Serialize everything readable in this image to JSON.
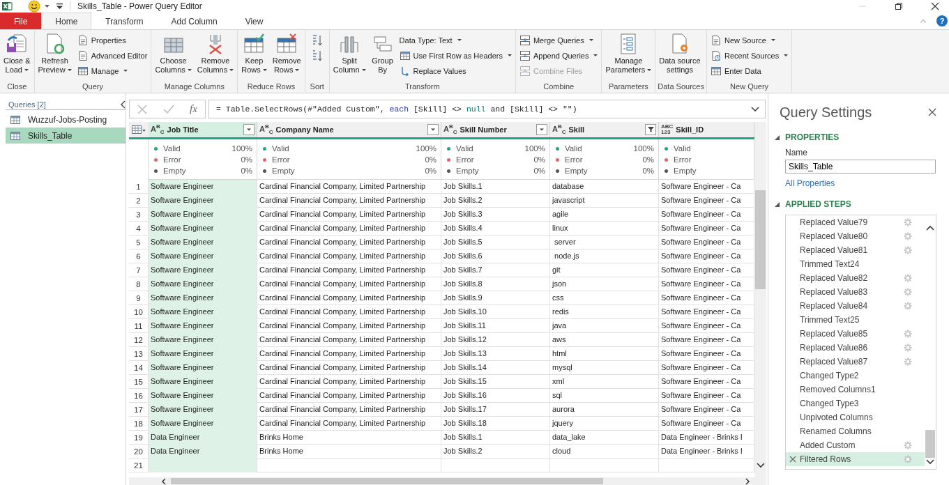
{
  "window": {
    "title": "Skills_Table - Power Query Editor"
  },
  "tabs": [
    {
      "label": "File",
      "kind": "file",
      "selected": false
    },
    {
      "label": "Home",
      "kind": "tab",
      "selected": true
    },
    {
      "label": "Transform",
      "kind": "tab",
      "selected": false
    },
    {
      "label": "Add Column",
      "kind": "tab",
      "selected": false
    },
    {
      "label": "View",
      "kind": "tab",
      "selected": false
    }
  ],
  "help": {
    "label": "?"
  },
  "ribbon": {
    "groups": [
      {
        "label": "Close",
        "items": [
          {
            "kind": "large",
            "lines": [
              "Close &",
              "Load"
            ],
            "dropdown": true
          }
        ]
      },
      {
        "label": "Query",
        "items": [
          {
            "kind": "large",
            "lines": [
              "Refresh",
              "Preview"
            ],
            "dropdown": true
          },
          {
            "kind": "stack",
            "items": [
              {
                "label": "Properties",
                "dropdown": false,
                "disabled": false
              },
              {
                "label": "Advanced Editor",
                "dropdown": false,
                "disabled": false
              },
              {
                "label": "Manage",
                "dropdown": true,
                "disabled": false
              }
            ]
          }
        ]
      },
      {
        "label": "Manage Columns",
        "items": [
          {
            "kind": "large",
            "lines": [
              "Choose",
              "Columns"
            ],
            "dropdown": true
          },
          {
            "kind": "large",
            "lines": [
              "Remove",
              "Columns"
            ],
            "dropdown": true
          }
        ]
      },
      {
        "label": "Reduce Rows",
        "items": [
          {
            "kind": "large",
            "lines": [
              "Keep",
              "Rows"
            ],
            "dropdown": true
          },
          {
            "kind": "large",
            "lines": [
              "Remove",
              "Rows"
            ],
            "dropdown": true
          }
        ]
      },
      {
        "label": "Sort",
        "items": [
          {
            "kind": "sort"
          }
        ]
      },
      {
        "label": "Transform",
        "items": [
          {
            "kind": "large",
            "lines": [
              "Split",
              "Column"
            ],
            "dropdown": true
          },
          {
            "kind": "large",
            "lines": [
              "Group",
              "By"
            ],
            "dropdown": false
          },
          {
            "kind": "stack",
            "items": [
              {
                "label": "Data Type: Text",
                "dropdown": true,
                "disabled": false
              },
              {
                "label": "Use First Row as Headers",
                "dropdown": true,
                "disabled": false
              },
              {
                "label": "Replace Values",
                "dropdown": false,
                "disabled": false
              }
            ]
          }
        ]
      },
      {
        "label": "Combine",
        "items": [
          {
            "kind": "stack",
            "items": [
              {
                "label": "Merge Queries",
                "dropdown": true,
                "disabled": false
              },
              {
                "label": "Append Queries",
                "dropdown": true,
                "disabled": false
              },
              {
                "label": "Combine Files",
                "dropdown": false,
                "disabled": true
              }
            ]
          }
        ]
      },
      {
        "label": "Parameters",
        "items": [
          {
            "kind": "large",
            "lines": [
              "Manage",
              "Parameters"
            ],
            "dropdown": true
          }
        ]
      },
      {
        "label": "Data Sources",
        "items": [
          {
            "kind": "large",
            "lines": [
              "Data source",
              "settings"
            ],
            "dropdown": false
          }
        ]
      },
      {
        "label": "New Query",
        "items": [
          {
            "kind": "stack",
            "items": [
              {
                "label": "New Source",
                "dropdown": true,
                "disabled": false
              },
              {
                "label": "Recent Sources",
                "dropdown": true,
                "disabled": false
              },
              {
                "label": "Enter Data",
                "dropdown": false,
                "disabled": false
              }
            ]
          }
        ]
      }
    ]
  },
  "queries": {
    "title": "Queries [2]",
    "items": [
      {
        "name": "Wuzzuf-Jobs-Posting",
        "selected": false
      },
      {
        "name": "Skills_Table",
        "selected": true
      }
    ]
  },
  "formula": {
    "fx": "fx",
    "tokens": [
      {
        "text": "= Table.SelectRows(#\"Added Custom\", ",
        "kind": "plain"
      },
      {
        "text": "each",
        "kind": "keyword"
      },
      {
        "text": " [Skill] <> ",
        "kind": "plain"
      },
      {
        "text": "null",
        "kind": "constant"
      },
      {
        "text": " and [Skill] <> \"\")",
        "kind": "plain"
      }
    ]
  },
  "grid": {
    "columns": [
      {
        "name": "Job Title",
        "kind": "text",
        "type_label": [
          "A$^{B}$$_{C}$"
        ],
        "selected": true,
        "filtered": false,
        "quality": [
          {
            "label": "Valid",
            "value": "100%",
            "color": "#1aa88f"
          },
          {
            "label": "Error",
            "value": "0%",
            "color": "#e8626a"
          },
          {
            "label": "Empty",
            "value": "0%",
            "color": "#555555"
          }
        ]
      },
      {
        "name": "Company Name",
        "kind": "text",
        "type_label": [
          "A$^{B}$$_{C}$"
        ],
        "selected": false,
        "filtered": false,
        "quality": [
          {
            "label": "Valid",
            "value": "100%",
            "color": "#1aa88f"
          },
          {
            "label": "Error",
            "value": "0%",
            "color": "#e8626a"
          },
          {
            "label": "Empty",
            "value": "0%",
            "color": "#555555"
          }
        ]
      },
      {
        "name": "Skill Number",
        "kind": "text",
        "type_label": [
          "A$^{B}$$_{C}$"
        ],
        "selected": false,
        "filtered": false,
        "quality": [
          {
            "label": "Valid",
            "value": "100%",
            "color": "#1aa88f"
          },
          {
            "label": "Error",
            "value": "0%",
            "color": "#e8626a"
          },
          {
            "label": "Empty",
            "value": "0%",
            "color": "#555555"
          }
        ]
      },
      {
        "name": "Skill",
        "kind": "text",
        "type_label": [
          "A$^{B}$$_{C}$"
        ],
        "selected": false,
        "filtered": true,
        "quality": [
          {
            "label": "Valid",
            "value": "100%",
            "color": "#1aa88f"
          },
          {
            "label": "Error",
            "value": "0%",
            "color": "#e8626a"
          },
          {
            "label": "Empty",
            "value": "0%",
            "color": "#555555"
          }
        ]
      },
      {
        "name": "Skill_ID",
        "kind": "any",
        "type_label": [
          "ABC",
          "123"
        ],
        "selected": false,
        "quality": [
          {
            "label": "Valid",
            "color": "#1aa88f"
          },
          {
            "label": "Error",
            "color": "#e8626a"
          },
          {
            "label": "Empty",
            "color": "#555555"
          }
        ]
      }
    ],
    "rows": [
      {
        "number": "1",
        "cells": [
          "Software Engineer",
          "Cardinal Financial Company, Limited Partnership",
          "Job Skills.1",
          "database",
          "Software Engineer - Ca"
        ]
      },
      {
        "number": "2",
        "cells": [
          "Software Engineer",
          "Cardinal Financial Company, Limited Partnership",
          "Job Skills.2",
          "javascript",
          "Software Engineer - Ca"
        ]
      },
      {
        "number": "3",
        "cells": [
          "Software Engineer",
          "Cardinal Financial Company, Limited Partnership",
          "Job Skills.3",
          "agile",
          "Software Engineer - Ca"
        ]
      },
      {
        "number": "4",
        "cells": [
          "Software Engineer",
          "Cardinal Financial Company, Limited Partnership",
          "Job Skills.4",
          "linux",
          "Software Engineer - Ca"
        ]
      },
      {
        "number": "5",
        "cells": [
          "Software Engineer",
          "Cardinal Financial Company, Limited Partnership",
          "Job Skills.5",
          " server",
          "Software Engineer - Ca"
        ]
      },
      {
        "number": "6",
        "cells": [
          "Software Engineer",
          "Cardinal Financial Company, Limited Partnership",
          "Job Skills.6",
          " node.js",
          "Software Engineer - Ca"
        ]
      },
      {
        "number": "7",
        "cells": [
          "Software Engineer",
          "Cardinal Financial Company, Limited Partnership",
          "Job Skills.7",
          "git",
          "Software Engineer - Ca"
        ]
      },
      {
        "number": "8",
        "cells": [
          "Software Engineer",
          "Cardinal Financial Company, Limited Partnership",
          "Job Skills.8",
          "json",
          "Software Engineer - Ca"
        ]
      },
      {
        "number": "9",
        "cells": [
          "Software Engineer",
          "Cardinal Financial Company, Limited Partnership",
          "Job Skills.9",
          "css",
          "Software Engineer - Ca"
        ]
      },
      {
        "number": "10",
        "cells": [
          "Software Engineer",
          "Cardinal Financial Company, Limited Partnership",
          "Job Skills.10",
          "redis",
          "Software Engineer - Ca"
        ]
      },
      {
        "number": "11",
        "cells": [
          "Software Engineer",
          "Cardinal Financial Company, Limited Partnership",
          "Job Skills.11",
          "java",
          "Software Engineer - Ca"
        ]
      },
      {
        "number": "12",
        "cells": [
          "Software Engineer",
          "Cardinal Financial Company, Limited Partnership",
          "Job Skills.12",
          "aws",
          "Software Engineer - Ca"
        ]
      },
      {
        "number": "13",
        "cells": [
          "Software Engineer",
          "Cardinal Financial Company, Limited Partnership",
          "Job Skills.13",
          "html",
          "Software Engineer - Ca"
        ]
      },
      {
        "number": "14",
        "cells": [
          "Software Engineer",
          "Cardinal Financial Company, Limited Partnership",
          "Job Skills.14",
          "mysql",
          "Software Engineer - Ca"
        ]
      },
      {
        "number": "15",
        "cells": [
          "Software Engineer",
          "Cardinal Financial Company, Limited Partnership",
          "Job Skills.15",
          "xml",
          "Software Engineer - Ca"
        ]
      },
      {
        "number": "16",
        "cells": [
          "Software Engineer",
          "Cardinal Financial Company, Limited Partnership",
          "Job Skills.16",
          "sql",
          "Software Engineer - Ca"
        ]
      },
      {
        "number": "17",
        "cells": [
          "Software Engineer",
          "Cardinal Financial Company, Limited Partnership",
          "Job Skills.17",
          "aurora",
          "Software Engineer - Ca"
        ]
      },
      {
        "number": "18",
        "cells": [
          "Software Engineer",
          "Cardinal Financial Company, Limited Partnership",
          "Job Skills.18",
          "jquery",
          "Software Engineer - Ca"
        ]
      },
      {
        "number": "19",
        "cells": [
          "Data Engineer",
          "Brinks Home",
          "Job Skills.1",
          "data_lake",
          "Data Engineer - Brinks I"
        ]
      },
      {
        "number": "20",
        "cells": [
          "Data Engineer",
          "Brinks Home",
          "Job Skills.2",
          "cloud",
          "Data Engineer - Brinks I"
        ]
      },
      {
        "number": "21",
        "cells": []
      }
    ]
  },
  "settings": {
    "title": "Query Settings",
    "properties": {
      "heading": "PROPERTIES",
      "expanded": true,
      "name_label": "Name",
      "name_value": "Skills_Table",
      "link": "All Properties"
    },
    "steps": {
      "heading": "APPLIED STEPS",
      "expanded": true,
      "items": [
        {
          "name": "Replaced Value79",
          "settings": true,
          "selected": false
        },
        {
          "name": "Replaced Value80",
          "settings": true,
          "selected": false
        },
        {
          "name": "Replaced Value81",
          "settings": true,
          "selected": false
        },
        {
          "name": "Trimmed Text24",
          "settings": false,
          "selected": false
        },
        {
          "name": "Replaced Value82",
          "settings": true,
          "selected": false
        },
        {
          "name": "Replaced Value83",
          "settings": true,
          "selected": false
        },
        {
          "name": "Replaced Value84",
          "settings": true,
          "selected": false
        },
        {
          "name": "Trimmed Text25",
          "settings": false,
          "selected": false
        },
        {
          "name": "Replaced Value85",
          "settings": true,
          "selected": false
        },
        {
          "name": "Replaced Value86",
          "settings": true,
          "selected": false
        },
        {
          "name": "Replaced Value87",
          "settings": true,
          "selected": false
        },
        {
          "name": "Changed Type2",
          "settings": false,
          "selected": false
        },
        {
          "name": "Removed Columns1",
          "settings": false,
          "selected": false
        },
        {
          "name": "Changed Type3",
          "settings": false,
          "selected": false
        },
        {
          "name": "Unpivoted Columns",
          "settings": false,
          "selected": false
        },
        {
          "name": "Renamed Columns",
          "settings": false,
          "selected": false
        },
        {
          "name": "Added Custom",
          "settings": true,
          "selected": false
        },
        {
          "name": "Filtered Rows",
          "settings": true,
          "selected": true
        }
      ]
    }
  }
}
